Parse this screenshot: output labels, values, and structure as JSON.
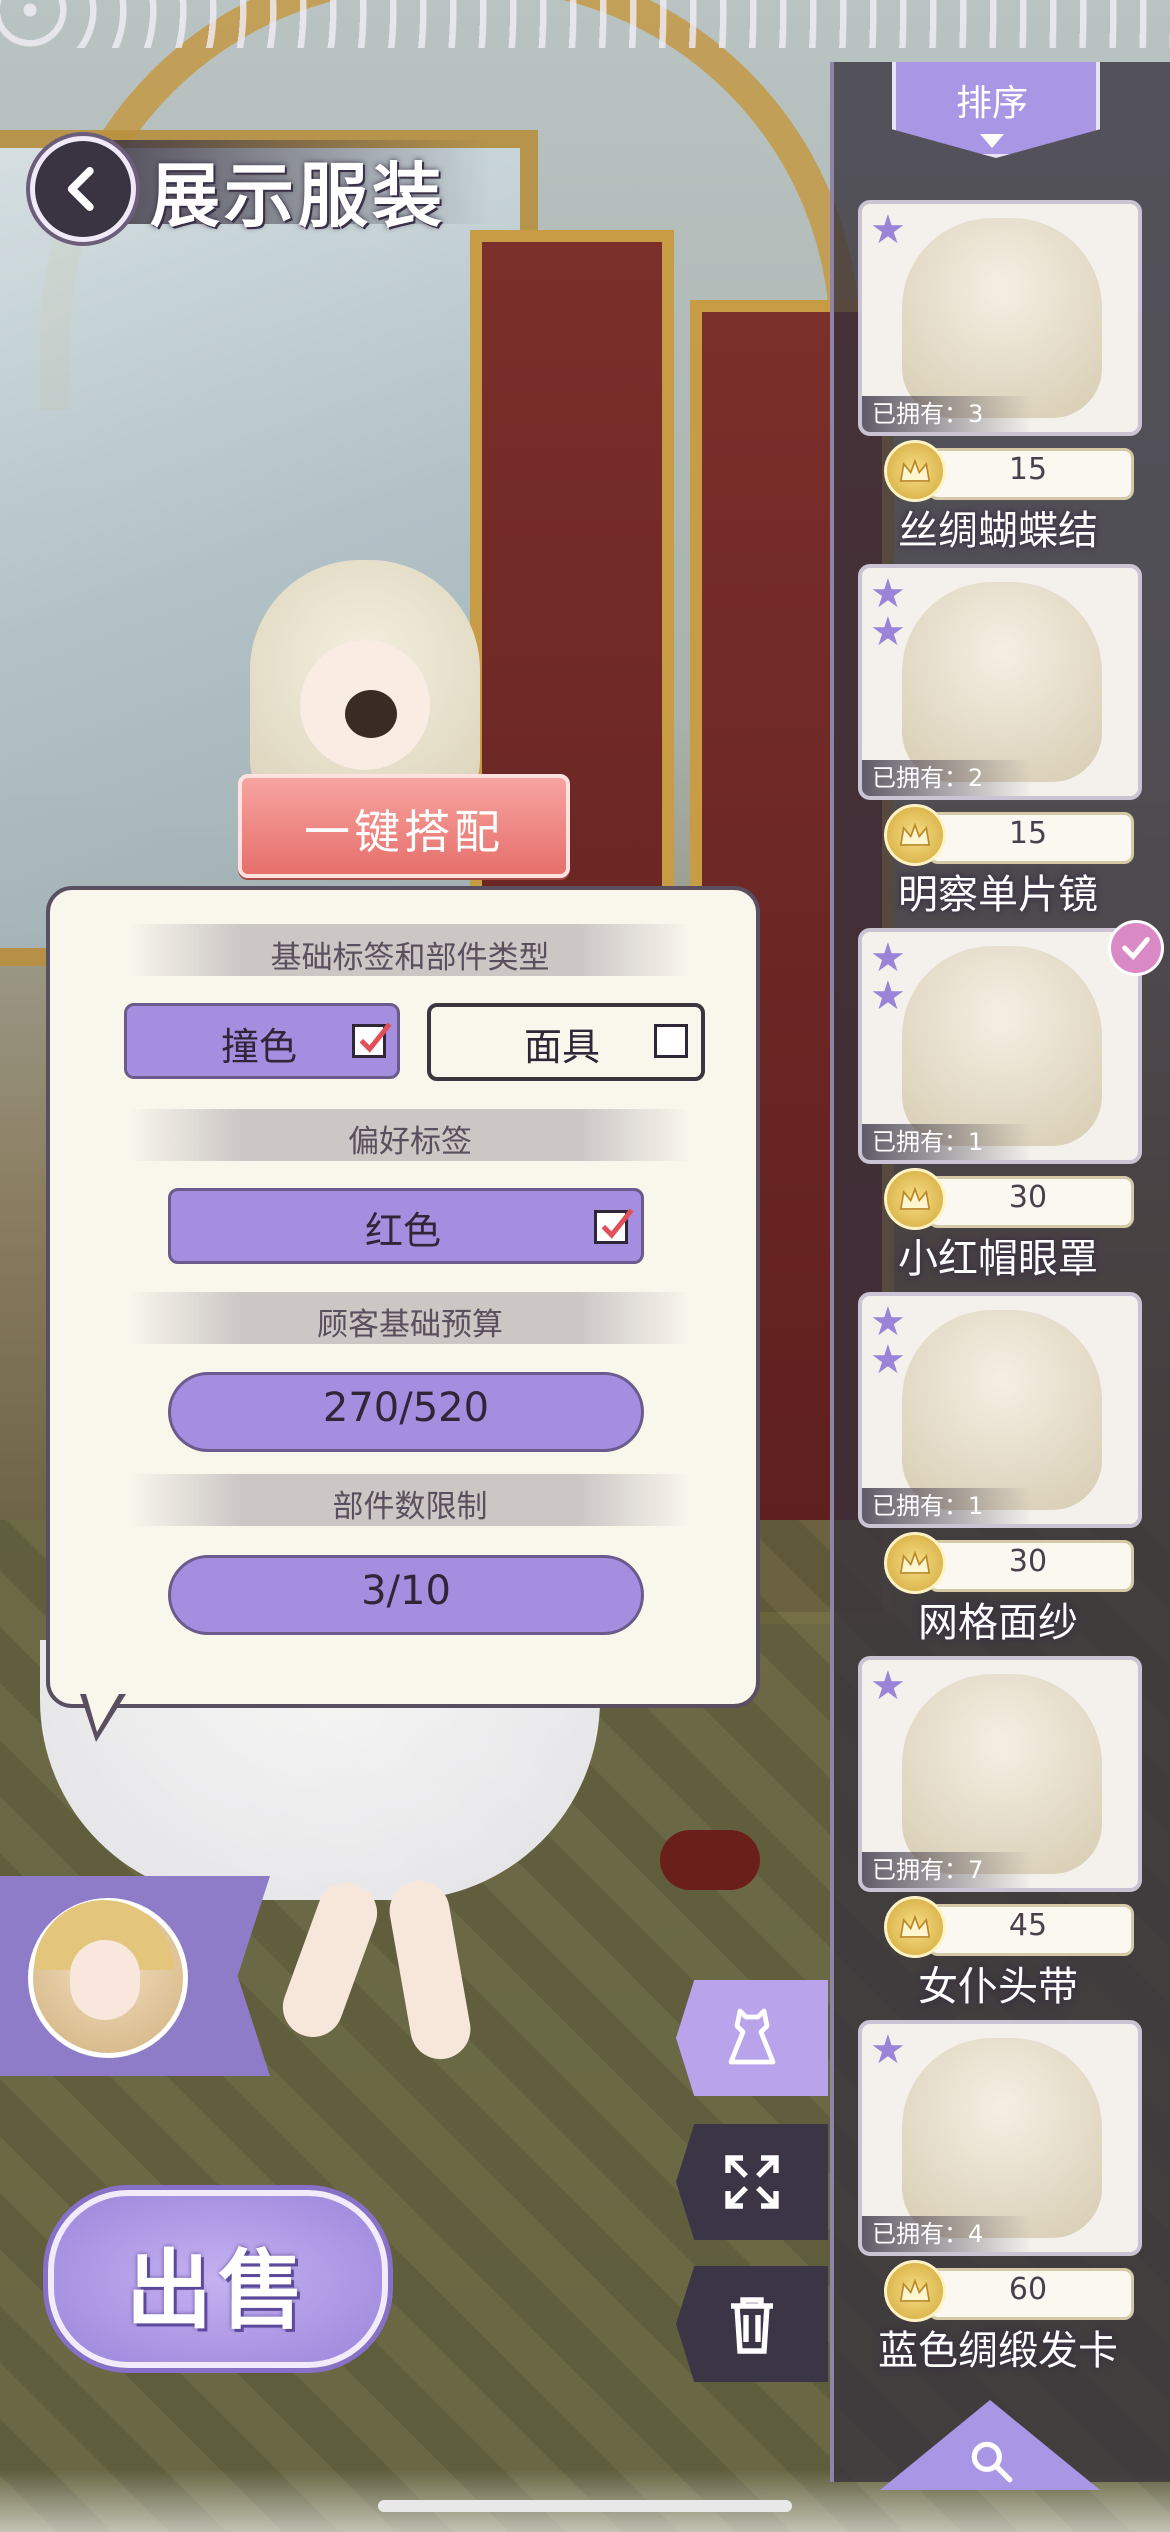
{
  "header": {
    "title": "展示服装"
  },
  "sort": {
    "label": "排序"
  },
  "auto_match": {
    "label": "一键搭配"
  },
  "dialog": {
    "section1": "基础标签和部件类型",
    "tags": [
      {
        "label": "撞色",
        "checked": true
      },
      {
        "label": "面具",
        "checked": false
      }
    ],
    "section2": "偏好标签",
    "preference": {
      "label": "红色",
      "checked": true
    },
    "section3": "顾客基础预算",
    "budget": "270/520",
    "section4": "部件数限制",
    "parts_limit": "3/10"
  },
  "items": [
    {
      "name": "丝绸蝴蝶结",
      "price": "15",
      "owned": "已拥有：3",
      "stars": 1,
      "selected": false
    },
    {
      "name": "明察单片镜",
      "price": "15",
      "owned": "已拥有：2",
      "stars": 2,
      "selected": false
    },
    {
      "name": "小红帽眼罩",
      "price": "30",
      "owned": "已拥有：1",
      "stars": 2,
      "selected": true
    },
    {
      "name": "网格面纱",
      "price": "30",
      "owned": "已拥有：1",
      "stars": 2,
      "selected": false
    },
    {
      "name": "女仆头带",
      "price": "45",
      "owned": "已拥有：7",
      "stars": 1,
      "selected": false
    },
    {
      "name": "蓝色绸缎发卡",
      "price": "60",
      "owned": "已拥有：4",
      "stars": 1,
      "selected": false
    }
  ],
  "sell": {
    "label": "出售"
  },
  "colors": {
    "accent": "#a48ee0",
    "auto_button": "#e66f6b",
    "panel": "#37323c",
    "check": "#e0505a"
  },
  "icons": [
    "back-arrow-icon",
    "crown-icon",
    "star-icon",
    "checkmark-icon",
    "dress-icon",
    "expand-icon",
    "trash-icon",
    "search-icon"
  ]
}
